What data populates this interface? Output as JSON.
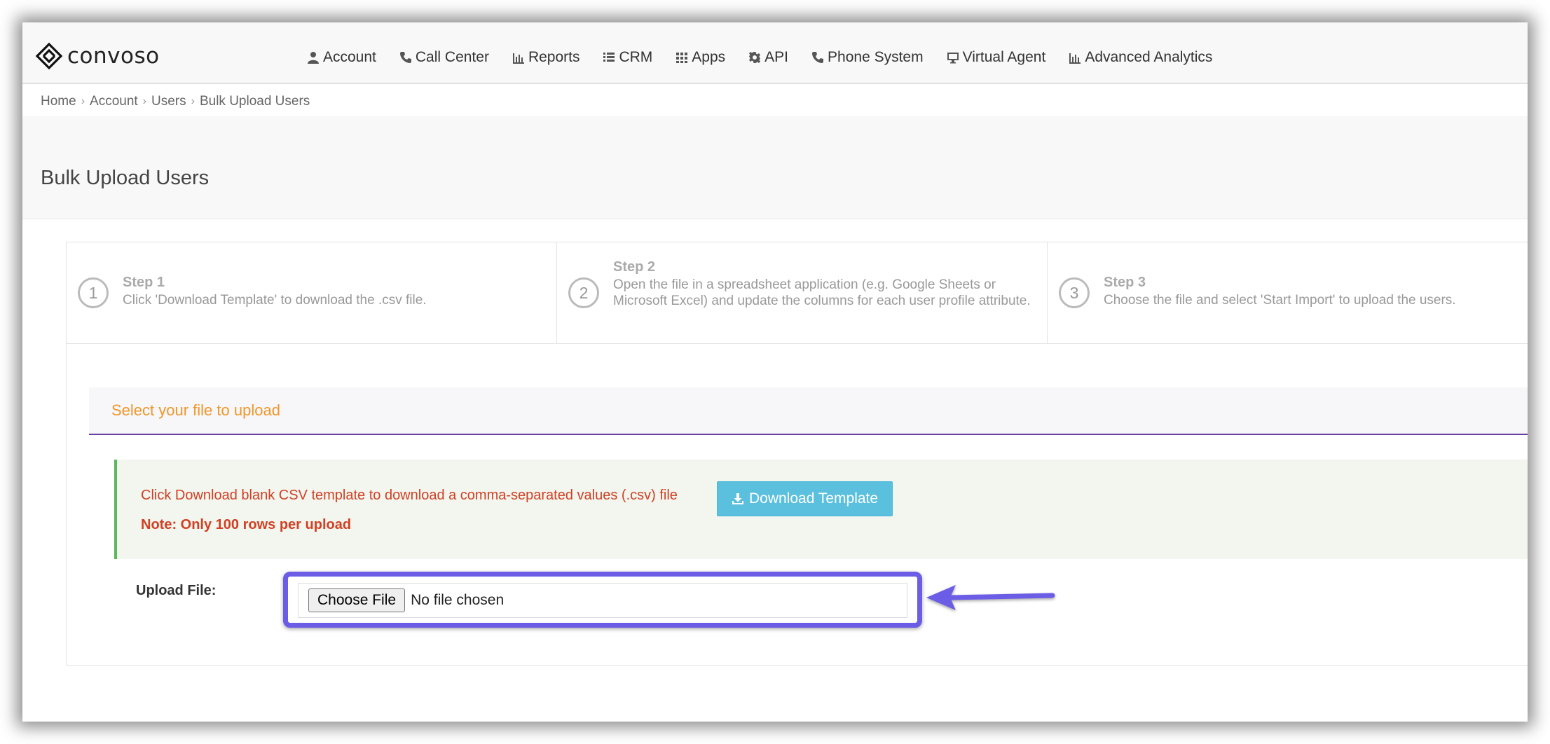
{
  "brand": {
    "name": "convoso"
  },
  "nav": [
    {
      "label": "Account",
      "icon": "user-icon"
    },
    {
      "label": "Call Center",
      "icon": "phone-icon"
    },
    {
      "label": "Reports",
      "icon": "bar-chart-icon"
    },
    {
      "label": "CRM",
      "icon": "list-icon"
    },
    {
      "label": "Apps",
      "icon": "grid-icon"
    },
    {
      "label": "API",
      "icon": "gear-icon"
    },
    {
      "label": "Phone System",
      "icon": "phone-icon"
    },
    {
      "label": "Virtual Agent",
      "icon": "monitor-icon"
    },
    {
      "label": "Advanced Analytics",
      "icon": "bar-chart-icon"
    }
  ],
  "breadcrumb": {
    "items": [
      "Home",
      "Account",
      "Users"
    ],
    "current": "Bulk Upload Users"
  },
  "page": {
    "title": "Bulk Upload Users"
  },
  "steps": [
    {
      "number": "1",
      "title": "Step 1",
      "desc": "Click 'Download Template' to download the .csv file."
    },
    {
      "number": "2",
      "title": "Step 2",
      "desc": "Open the file in a spreadsheet application (e.g. Google Sheets or Microsoft Excel) and update the columns for each user profile attribute."
    },
    {
      "number": "3",
      "title": "Step 3",
      "desc": "Choose the file and select 'Start Import' to upload the users."
    }
  ],
  "upload_section": {
    "title": "Select your file to upload",
    "alert_text": "Click Download blank CSV template to download a comma-separated values (.csv) file",
    "download_button": "Download Template",
    "note": "Note: Only 100 rows per upload",
    "upload_label": "Upload File:",
    "choose_button": "Choose File",
    "file_status": "No file chosen"
  },
  "colors": {
    "accent_orange": "#f0962a",
    "section_underline": "#6b3fa0",
    "alert_red": "#d14023",
    "alert_border_green": "#5cb85c",
    "download_button_blue": "#5bc0de",
    "highlight_purple": "#6b5de6"
  }
}
